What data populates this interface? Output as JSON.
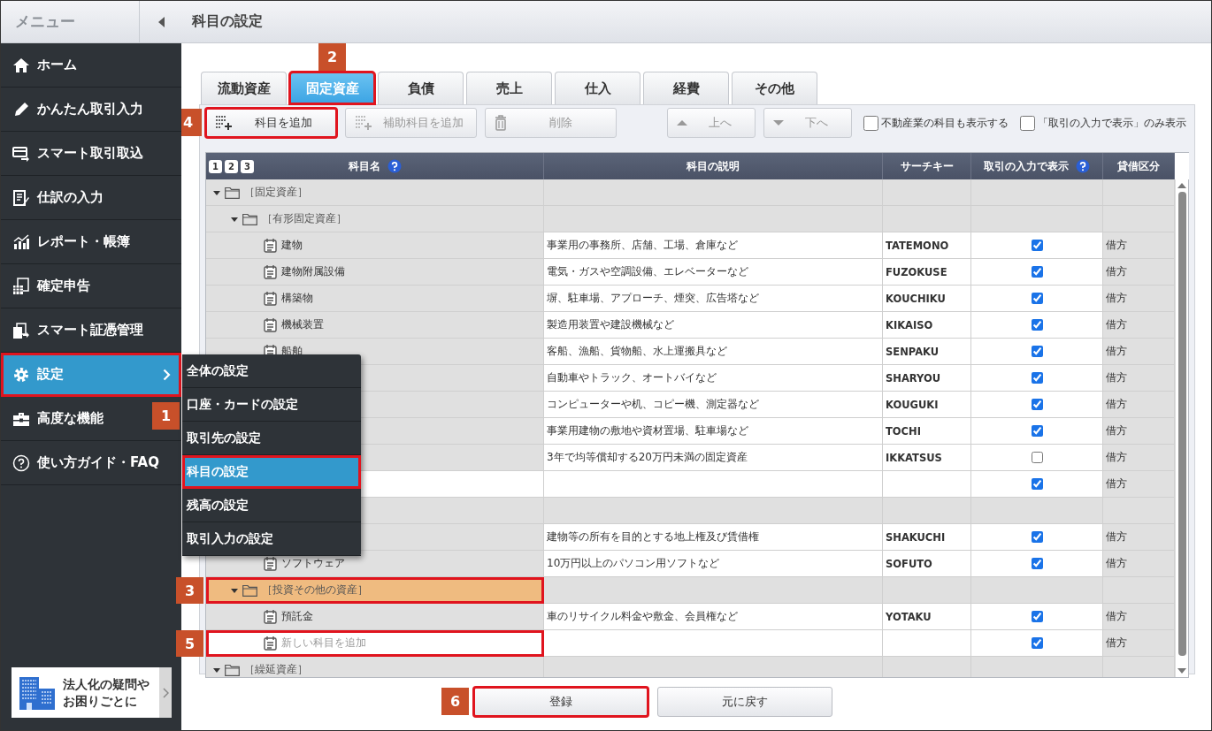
{
  "sidebar": {
    "title": "メニュー",
    "items": [
      {
        "label": "ホーム",
        "selected": false
      },
      {
        "label": "かんたん取引入力",
        "selected": false
      },
      {
        "label": "スマート取引取込",
        "selected": false
      },
      {
        "label": "仕訳の入力",
        "selected": false
      },
      {
        "label": "レポート・帳簿",
        "selected": false
      },
      {
        "label": "確定申告",
        "selected": false
      },
      {
        "label": "スマート証憑管理",
        "selected": false
      },
      {
        "label": "設定",
        "selected": true,
        "outlined": true,
        "callout": "1"
      },
      {
        "label": "高度な機能",
        "selected": false
      },
      {
        "label": "使い方ガイド・FAQ",
        "selected": false
      }
    ],
    "promo": {
      "lines": [
        "法人化の疑問や",
        "お困りごとに"
      ]
    }
  },
  "submenu": {
    "items": [
      {
        "label": "全体の設定",
        "selected": false,
        "outlined": false
      },
      {
        "label": "口座・カードの設定",
        "selected": false,
        "outlined": false
      },
      {
        "label": "取引先の設定",
        "selected": false,
        "outlined": false
      },
      {
        "label": "科目の設定",
        "selected": true,
        "outlined": true
      },
      {
        "label": "残高の設定",
        "selected": false,
        "outlined": false
      },
      {
        "label": "取引入力の設定",
        "selected": false,
        "outlined": false
      }
    ]
  },
  "page": {
    "title": "科目の設定"
  },
  "tabs": [
    {
      "label": "流動資産",
      "selected": false
    },
    {
      "label": "固定資産",
      "selected": true,
      "outlined": true,
      "callout": "2"
    },
    {
      "label": "負債",
      "selected": false
    },
    {
      "label": "売上",
      "selected": false
    },
    {
      "label": "仕入",
      "selected": false
    },
    {
      "label": "経費",
      "selected": false
    },
    {
      "label": "その他",
      "selected": false
    }
  ],
  "toolbar": {
    "buttons": [
      {
        "label": "科目を追加",
        "kind": "add",
        "disabled": false,
        "outlined": true,
        "callout": "4"
      },
      {
        "label": "補助科目を追加",
        "kind": "add",
        "disabled": true
      },
      {
        "label": "削除",
        "kind": "delete",
        "disabled": true
      },
      {
        "label": "上へ",
        "kind": "up",
        "disabled": true
      },
      {
        "label": "下へ",
        "kind": "down",
        "disabled": true
      }
    ],
    "options": [
      {
        "label": "不動産業の科目も表示する",
        "checked": false
      },
      {
        "label": "「取引の入力で表示」のみ表示",
        "checked": false
      }
    ]
  },
  "table": {
    "levels": [
      "1",
      "2",
      "3"
    ],
    "columns": [
      {
        "label": "科目名",
        "help": true
      },
      {
        "label": "科目の説明",
        "help": false
      },
      {
        "label": "サーチキー",
        "help": false
      },
      {
        "label": "取引の入力で表示",
        "help": true
      },
      {
        "label": "貸借区分",
        "help": false
      }
    ],
    "tree": [
      {
        "kind": "group",
        "name": "［固定資産］",
        "expanded": true,
        "children": [
          {
            "kind": "group",
            "name": "［有形固定資産］",
            "expanded": true,
            "children": [
              {
                "kind": "item",
                "name": "建物",
                "description": "事業用の事務所、店舗、工場、倉庫など",
                "search_key": "TATEMONO",
                "show_in_entry": true,
                "side": "借方"
              },
              {
                "kind": "item",
                "name": "建物附属設備",
                "description": "電気・ガスや空調設備、エレベーターなど",
                "search_key": "FUZOKUSE",
                "show_in_entry": true,
                "side": "借方"
              },
              {
                "kind": "item",
                "name": "構築物",
                "description": "塀、駐車場、アプローチ、煙突、広告塔など",
                "search_key": "KOUCHIKU",
                "show_in_entry": true,
                "side": "借方"
              },
              {
                "kind": "item",
                "name": "機械装置",
                "description": "製造用装置や建設機械など",
                "search_key": "KIKAISO",
                "show_in_entry": true,
                "side": "借方"
              },
              {
                "kind": "item",
                "name": "船舶",
                "description": "客船、漁船、貨物船、水上運搬具など",
                "search_key": "SENPAKU",
                "show_in_entry": true,
                "side": "借方"
              },
              {
                "kind": "item",
                "description": "自動車やトラック、オートバイなど",
                "search_key": "SHARYOU",
                "show_in_entry": true,
                "side": "借方"
              },
              {
                "kind": "item",
                "description": "コンピューターや机、コピー機、測定器など",
                "search_key": "KOUGUKI",
                "show_in_entry": true,
                "side": "借方"
              },
              {
                "kind": "item",
                "description": "事業用建物の敷地や資材置場、駐車場など",
                "search_key": "TOCHI",
                "show_in_entry": true,
                "side": "借方"
              },
              {
                "kind": "item",
                "description": "3年で均等償却する20万円未満の固定資産",
                "search_key": "IKKATSUS",
                "show_in_entry": false,
                "side": "借方"
              },
              {
                "kind": "new",
                "show_in_entry": true,
                "side": "借方"
              }
            ]
          },
          {
            "kind": "group",
            "children": [
              {
                "kind": "item",
                "description": "建物等の所有を目的とする地上権及び賃借権",
                "search_key": "SHAKUCHI",
                "show_in_entry": true,
                "side": "借方"
              },
              {
                "kind": "item",
                "name": "ソフトウェア",
                "description": "10万円以上のパソコン用ソフトなど",
                "search_key": "SOFUTO",
                "show_in_entry": true,
                "side": "借方"
              }
            ]
          },
          {
            "kind": "group",
            "name": "［投資その他の資産］",
            "expanded": true,
            "highlighted": true,
            "outlined": true,
            "callout": "3",
            "children": [
              {
                "kind": "item",
                "name": "預託金",
                "description": "車のリサイクル料金や敷金、会員権など",
                "search_key": "YOTAKU",
                "show_in_entry": true,
                "side": "借方"
              },
              {
                "kind": "new",
                "name": "新しい科目を追加",
                "show_in_entry": true,
                "side": "借方",
                "outlined": true,
                "callout": "5"
              }
            ]
          }
        ]
      },
      {
        "kind": "group",
        "name": "［繰延資産］",
        "expanded": true
      }
    ]
  },
  "footer": {
    "buttons": [
      {
        "label": "登録",
        "outlined": true,
        "callout": "6"
      },
      {
        "label": "元に戻す",
        "outlined": false
      }
    ]
  }
}
